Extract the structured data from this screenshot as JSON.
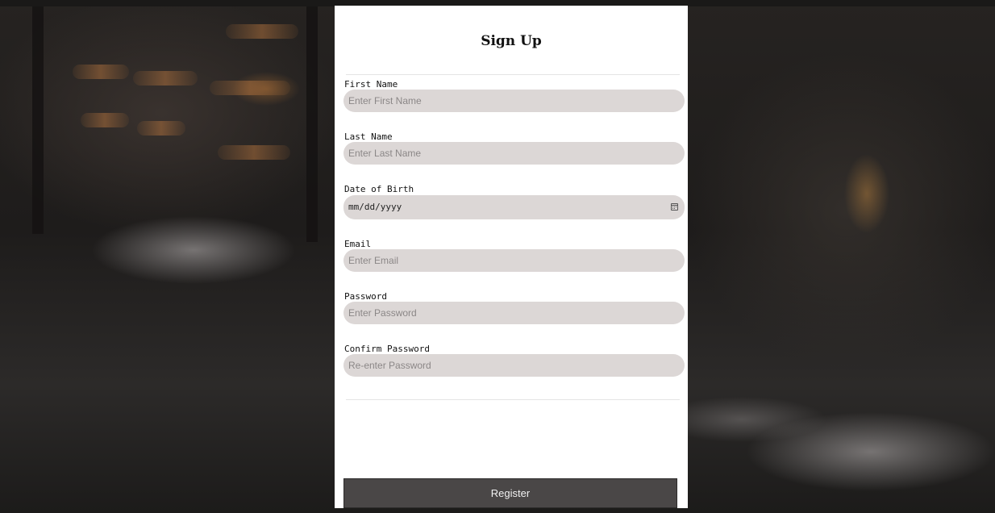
{
  "form": {
    "title": "Sign Up",
    "fields": [
      {
        "label": "First Name",
        "placeholder": "Enter First Name",
        "type": "text"
      },
      {
        "label": "Last Name",
        "placeholder": "Enter Last Name",
        "type": "text"
      },
      {
        "label": "Date of Birth",
        "placeholder": "mm/dd/yyyy",
        "type": "date",
        "icon": "calendar-icon"
      },
      {
        "label": "Email",
        "placeholder": "Enter Email",
        "type": "email"
      },
      {
        "label": "Password",
        "placeholder": "Enter Password",
        "type": "password"
      },
      {
        "label": "Confirm Password",
        "placeholder": "Re-enter Password",
        "type": "password"
      }
    ],
    "submit_label": "Register"
  },
  "colors": {
    "card_background": "#ffffff",
    "input_background": "#dcd7d6",
    "button_background": "#4a4747",
    "button_text": "#f2f2f2"
  }
}
